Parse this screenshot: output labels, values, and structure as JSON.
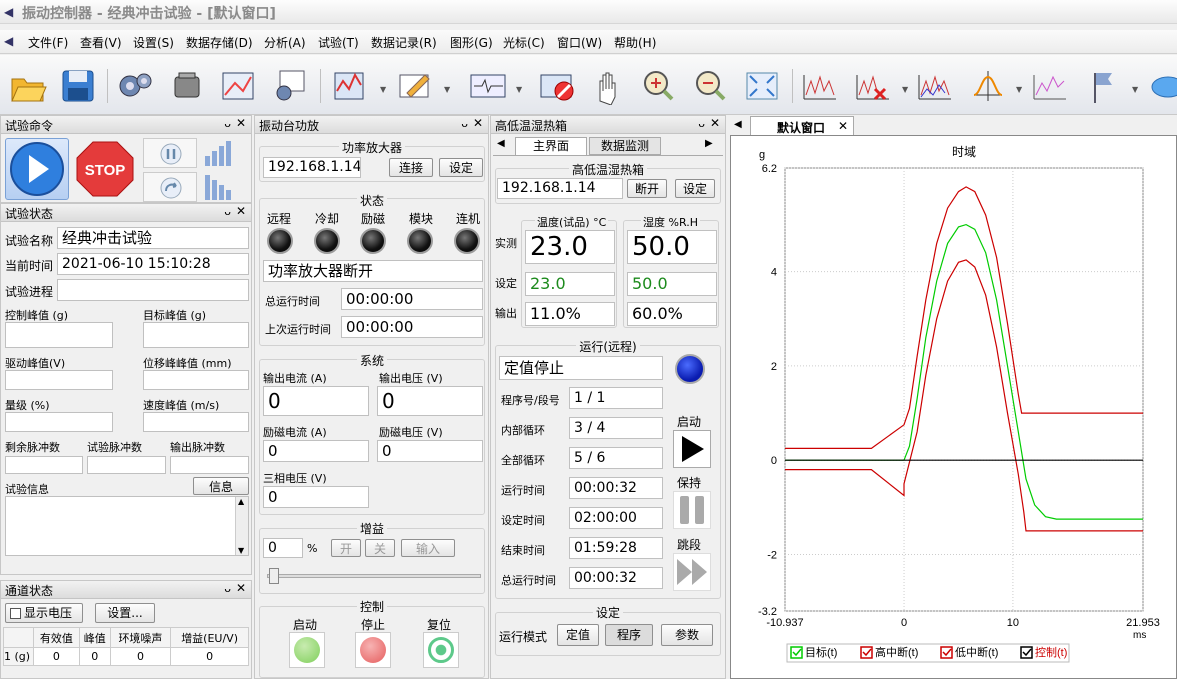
{
  "window": {
    "title": "振动控制器 - 经典冲击试验 - [默认窗口]"
  },
  "menu": [
    "文件(F)",
    "查看(V)",
    "设置(S)",
    "数据存储(D)",
    "分析(A)",
    "试验(T)",
    "数据记录(R)",
    "图形(G)",
    "光标(C)",
    "窗口(W)",
    "帮助(H)"
  ],
  "test_cmd": {
    "title": "试验命令"
  },
  "test_status": {
    "title": "试验状态",
    "name_label": "试验名称",
    "name": "经典冲击试验",
    "time_label": "当前时间",
    "time": "2021-06-10 15:10:28",
    "progress_label": "试验进程",
    "control_peak": "控制峰值 (g)",
    "target_peak": "目标峰值 (g)",
    "drive_peak": "驱动峰值(V)",
    "disp_peak": "位移峰峰值 (mm)",
    "level": "量级 (%)",
    "vel_peak": "速度峰值 (m/s)",
    "remain_pulses": "剩余脉冲数",
    "test_pulses": "试验脉冲数",
    "out_pulses": "输出脉冲数",
    "info_label": "试验信息",
    "info_btn": "信息"
  },
  "channel": {
    "title": "通道状态",
    "show_voltage": "显示电压",
    "settings": "设置...",
    "headers": [
      "",
      "有效值",
      "峰值",
      "环境噪声",
      "增益(EU/V)"
    ],
    "rows": [
      [
        "1 (g)",
        "0",
        "0",
        "0",
        "0"
      ]
    ]
  },
  "shaker": {
    "title": "振动台功放",
    "amp_title": "功率放大器",
    "ip": "192.168.1.14",
    "connect": "连接",
    "setup": "设定",
    "state_title": "状态",
    "leds": [
      "远程",
      "冷却",
      "励磁",
      "模块",
      "连机"
    ],
    "amp_state": "功率放大器断开",
    "total_time_label": "总运行时间",
    "total_time": "00:00:00",
    "last_time_label": "上次运行时间",
    "last_time": "00:00:00",
    "sys_title": "系统",
    "out_current_label": "输出电流 (A)",
    "out_current": "0",
    "out_voltage_label": "输出电压 (V)",
    "out_voltage": "0",
    "ex_current_label": "励磁电流 (A)",
    "ex_current": "0",
    "ex_voltage_label": "励磁电压 (V)",
    "ex_voltage": "0",
    "three_phase_label": "三相电压 (V)",
    "three_phase": "0",
    "gain_title": "增益",
    "gain": "0",
    "gain_unit": "%",
    "on": "开",
    "off": "关",
    "input": "输入",
    "ctrl_title": "控制",
    "start": "启动",
    "stop": "停止",
    "reset": "复位"
  },
  "chamber": {
    "title": "高低温湿热箱",
    "tab_main": "主界面",
    "tab_monitor": "数据监测",
    "sub_title": "高低温湿热箱",
    "ip": "192.168.1.14",
    "disconnect": "断开",
    "setup": "设定",
    "temp_label": "温度(试品) °C",
    "hum_label": "湿度 %R.H",
    "actual_label": "实测",
    "temp_actual": "23.0",
    "hum_actual": "50.0",
    "set_label": "设定",
    "temp_set": "23.0",
    "hum_set": "50.0",
    "out_label": "输出",
    "temp_out": "11.0%",
    "hum_out": "60.0%",
    "run_title": "运行(远程)",
    "run_state": "定值停止",
    "prog_label": "程序号/段号",
    "prog": "1 / 1",
    "inner_label": "内部循环",
    "inner": "3 / 4",
    "all_label": "全部循环",
    "all": "5 / 6",
    "run_time_label": "运行时间",
    "run_time": "00:00:32",
    "set_time_label": "设定时间",
    "set_time": "02:00:00",
    "end_time_label": "结束时间",
    "end_time": "01:59:28",
    "total_label": "总运行时间",
    "total": "00:00:32",
    "start": "启动",
    "hold": "保持",
    "skip": "跳段",
    "set_title": "设定",
    "mode_label": "运行模式",
    "fixed": "定值",
    "program": "程序",
    "params": "参数"
  },
  "graph_tab": {
    "label": "默认窗口"
  },
  "chart_data": {
    "type": "line",
    "title": "时域",
    "xlabel": "ms",
    "ylabel": "g",
    "xlim": [
      -10.937,
      21.953
    ],
    "ylim": [
      -3.2,
      6.2
    ],
    "xticks": [
      "-10.937",
      "0",
      "10",
      "21.953"
    ],
    "yticks": [
      "6.2",
      "4",
      "2",
      "0",
      "-2",
      "-3.2"
    ],
    "series": [
      {
        "name": "目标(t)",
        "color": "#00cc00",
        "points": [
          [
            -10.937,
            0
          ],
          [
            0,
            0
          ],
          [
            0.5,
            0.3
          ],
          [
            1.2,
            1.3
          ],
          [
            2,
            2.6
          ],
          [
            3,
            3.8
          ],
          [
            4,
            4.6
          ],
          [
            5,
            4.95
          ],
          [
            5.7,
            5.0
          ],
          [
            6.5,
            4.9
          ],
          [
            7.5,
            4.4
          ],
          [
            8.5,
            3.4
          ],
          [
            9.5,
            2.0
          ],
          [
            10.5,
            0.6
          ],
          [
            11.2,
            -0.4
          ],
          [
            12,
            -0.95
          ],
          [
            13,
            -1.2
          ],
          [
            14,
            -1.25
          ],
          [
            21.953,
            -1.25
          ]
        ]
      },
      {
        "name": "高中断(t)",
        "color": "#cc0000",
        "points": [
          [
            -10.937,
            0.25
          ],
          [
            -3,
            0.25
          ],
          [
            0,
            0.75
          ],
          [
            0.5,
            1.1
          ],
          [
            1.2,
            2.2
          ],
          [
            2,
            3.4
          ],
          [
            3,
            4.6
          ],
          [
            4,
            5.35
          ],
          [
            5,
            5.7
          ],
          [
            5.7,
            5.8
          ],
          [
            6.5,
            5.7
          ],
          [
            7.5,
            5.2
          ],
          [
            8.5,
            4.3
          ],
          [
            9.5,
            2.9
          ],
          [
            10.5,
            1.4
          ],
          [
            10.8,
            1.0
          ],
          [
            21.953,
            1.0
          ]
        ]
      },
      {
        "name": "低中断(t)",
        "color": "#cc0000",
        "points": [
          [
            -10.937,
            -0.2
          ],
          [
            -3,
            -0.2
          ],
          [
            0,
            -0.75
          ],
          [
            0,
            -0.5
          ],
          [
            1.2,
            0.6
          ],
          [
            2,
            1.8
          ],
          [
            3,
            3.0
          ],
          [
            4,
            3.8
          ],
          [
            5,
            4.2
          ],
          [
            5.7,
            4.25
          ],
          [
            6.5,
            4.1
          ],
          [
            7.5,
            3.5
          ],
          [
            8.5,
            2.4
          ],
          [
            9.5,
            1.0
          ],
          [
            10.5,
            -0.3
          ],
          [
            11,
            -1.1
          ],
          [
            11.2,
            -1.5
          ],
          [
            21.953,
            -1.5
          ]
        ]
      },
      {
        "name": "控制(t)",
        "color": "#000000",
        "points": [
          [
            -10.937,
            0
          ],
          [
            21.953,
            0
          ]
        ]
      }
    ]
  }
}
